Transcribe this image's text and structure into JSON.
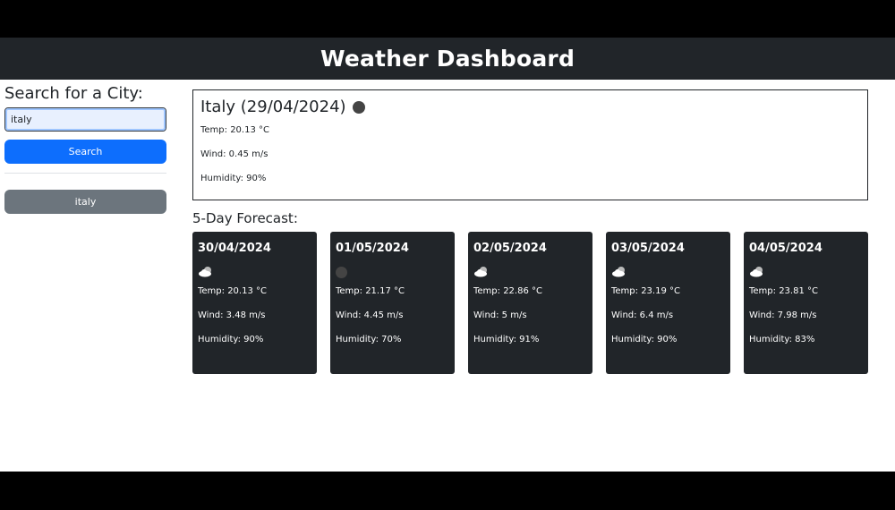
{
  "header": {
    "title": "Weather Dashboard"
  },
  "sidebar": {
    "heading": "Search for a City:",
    "search_value": "italy",
    "search_button": "Search",
    "history": [
      "italy"
    ]
  },
  "current": {
    "title": "Italy (29/04/2024)",
    "icon": "moon-icon",
    "temp": "Temp: 20.13 °C",
    "wind": "Wind: 0.45 m/s",
    "humidity": "Humidity: 90%"
  },
  "forecast": {
    "heading": "5-Day Forecast:",
    "days": [
      {
        "date": "30/04/2024",
        "icon": "cloud-icon",
        "temp": "Temp: 20.13 °C",
        "wind": "Wind: 3.48 m/s",
        "humidity": "Humidity: 90%"
      },
      {
        "date": "01/05/2024",
        "icon": "moon-icon",
        "temp": "Temp: 21.17 °C",
        "wind": "Wind: 4.45 m/s",
        "humidity": "Humidity: 70%"
      },
      {
        "date": "02/05/2024",
        "icon": "cloud-icon",
        "temp": "Temp: 22.86 °C",
        "wind": "Wind: 5 m/s",
        "humidity": "Humidity: 91%"
      },
      {
        "date": "03/05/2024",
        "icon": "cloud-icon",
        "temp": "Temp: 23.19 °C",
        "wind": "Wind: 6.4 m/s",
        "humidity": "Humidity: 90%"
      },
      {
        "date": "04/05/2024",
        "icon": "cloud-icon",
        "temp": "Temp: 23.81 °C",
        "wind": "Wind: 7.98 m/s",
        "humidity": "Humidity: 83%"
      }
    ]
  },
  "colors": {
    "dark": "#212529",
    "primary": "#0d6efd",
    "secondary": "#6c757d"
  }
}
